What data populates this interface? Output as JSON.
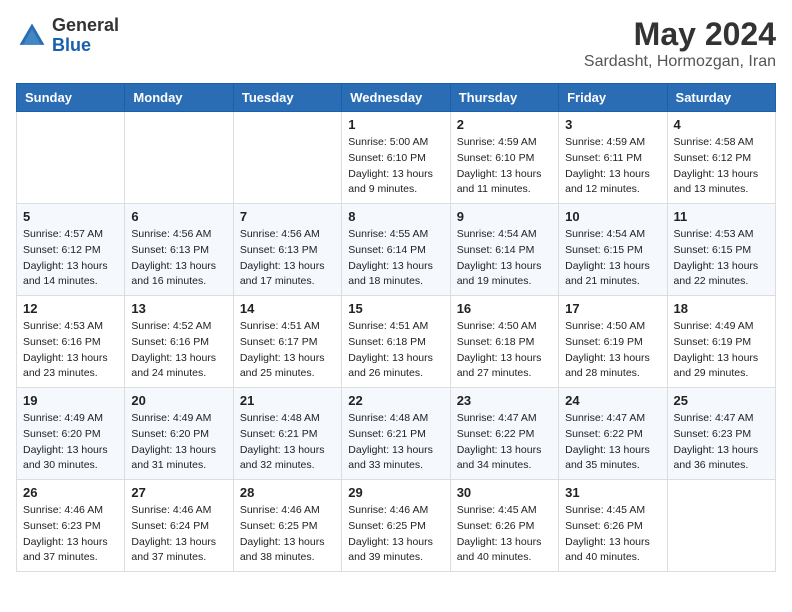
{
  "header": {
    "logo_general": "General",
    "logo_blue": "Blue",
    "month_title": "May 2024",
    "location": "Sardasht, Hormozgan, Iran"
  },
  "calendar": {
    "days_of_week": [
      "Sunday",
      "Monday",
      "Tuesday",
      "Wednesday",
      "Thursday",
      "Friday",
      "Saturday"
    ],
    "weeks": [
      [
        {
          "day": "",
          "info": ""
        },
        {
          "day": "",
          "info": ""
        },
        {
          "day": "",
          "info": ""
        },
        {
          "day": "1",
          "info": "Sunrise: 5:00 AM\nSunset: 6:10 PM\nDaylight: 13 hours\nand 9 minutes."
        },
        {
          "day": "2",
          "info": "Sunrise: 4:59 AM\nSunset: 6:10 PM\nDaylight: 13 hours\nand 11 minutes."
        },
        {
          "day": "3",
          "info": "Sunrise: 4:59 AM\nSunset: 6:11 PM\nDaylight: 13 hours\nand 12 minutes."
        },
        {
          "day": "4",
          "info": "Sunrise: 4:58 AM\nSunset: 6:12 PM\nDaylight: 13 hours\nand 13 minutes."
        }
      ],
      [
        {
          "day": "5",
          "info": "Sunrise: 4:57 AM\nSunset: 6:12 PM\nDaylight: 13 hours\nand 14 minutes."
        },
        {
          "day": "6",
          "info": "Sunrise: 4:56 AM\nSunset: 6:13 PM\nDaylight: 13 hours\nand 16 minutes."
        },
        {
          "day": "7",
          "info": "Sunrise: 4:56 AM\nSunset: 6:13 PM\nDaylight: 13 hours\nand 17 minutes."
        },
        {
          "day": "8",
          "info": "Sunrise: 4:55 AM\nSunset: 6:14 PM\nDaylight: 13 hours\nand 18 minutes."
        },
        {
          "day": "9",
          "info": "Sunrise: 4:54 AM\nSunset: 6:14 PM\nDaylight: 13 hours\nand 19 minutes."
        },
        {
          "day": "10",
          "info": "Sunrise: 4:54 AM\nSunset: 6:15 PM\nDaylight: 13 hours\nand 21 minutes."
        },
        {
          "day": "11",
          "info": "Sunrise: 4:53 AM\nSunset: 6:15 PM\nDaylight: 13 hours\nand 22 minutes."
        }
      ],
      [
        {
          "day": "12",
          "info": "Sunrise: 4:53 AM\nSunset: 6:16 PM\nDaylight: 13 hours\nand 23 minutes."
        },
        {
          "day": "13",
          "info": "Sunrise: 4:52 AM\nSunset: 6:16 PM\nDaylight: 13 hours\nand 24 minutes."
        },
        {
          "day": "14",
          "info": "Sunrise: 4:51 AM\nSunset: 6:17 PM\nDaylight: 13 hours\nand 25 minutes."
        },
        {
          "day": "15",
          "info": "Sunrise: 4:51 AM\nSunset: 6:18 PM\nDaylight: 13 hours\nand 26 minutes."
        },
        {
          "day": "16",
          "info": "Sunrise: 4:50 AM\nSunset: 6:18 PM\nDaylight: 13 hours\nand 27 minutes."
        },
        {
          "day": "17",
          "info": "Sunrise: 4:50 AM\nSunset: 6:19 PM\nDaylight: 13 hours\nand 28 minutes."
        },
        {
          "day": "18",
          "info": "Sunrise: 4:49 AM\nSunset: 6:19 PM\nDaylight: 13 hours\nand 29 minutes."
        }
      ],
      [
        {
          "day": "19",
          "info": "Sunrise: 4:49 AM\nSunset: 6:20 PM\nDaylight: 13 hours\nand 30 minutes."
        },
        {
          "day": "20",
          "info": "Sunrise: 4:49 AM\nSunset: 6:20 PM\nDaylight: 13 hours\nand 31 minutes."
        },
        {
          "day": "21",
          "info": "Sunrise: 4:48 AM\nSunset: 6:21 PM\nDaylight: 13 hours\nand 32 minutes."
        },
        {
          "day": "22",
          "info": "Sunrise: 4:48 AM\nSunset: 6:21 PM\nDaylight: 13 hours\nand 33 minutes."
        },
        {
          "day": "23",
          "info": "Sunrise: 4:47 AM\nSunset: 6:22 PM\nDaylight: 13 hours\nand 34 minutes."
        },
        {
          "day": "24",
          "info": "Sunrise: 4:47 AM\nSunset: 6:22 PM\nDaylight: 13 hours\nand 35 minutes."
        },
        {
          "day": "25",
          "info": "Sunrise: 4:47 AM\nSunset: 6:23 PM\nDaylight: 13 hours\nand 36 minutes."
        }
      ],
      [
        {
          "day": "26",
          "info": "Sunrise: 4:46 AM\nSunset: 6:23 PM\nDaylight: 13 hours\nand 37 minutes."
        },
        {
          "day": "27",
          "info": "Sunrise: 4:46 AM\nSunset: 6:24 PM\nDaylight: 13 hours\nand 37 minutes."
        },
        {
          "day": "28",
          "info": "Sunrise: 4:46 AM\nSunset: 6:25 PM\nDaylight: 13 hours\nand 38 minutes."
        },
        {
          "day": "29",
          "info": "Sunrise: 4:46 AM\nSunset: 6:25 PM\nDaylight: 13 hours\nand 39 minutes."
        },
        {
          "day": "30",
          "info": "Sunrise: 4:45 AM\nSunset: 6:26 PM\nDaylight: 13 hours\nand 40 minutes."
        },
        {
          "day": "31",
          "info": "Sunrise: 4:45 AM\nSunset: 6:26 PM\nDaylight: 13 hours\nand 40 minutes."
        },
        {
          "day": "",
          "info": ""
        }
      ]
    ]
  }
}
